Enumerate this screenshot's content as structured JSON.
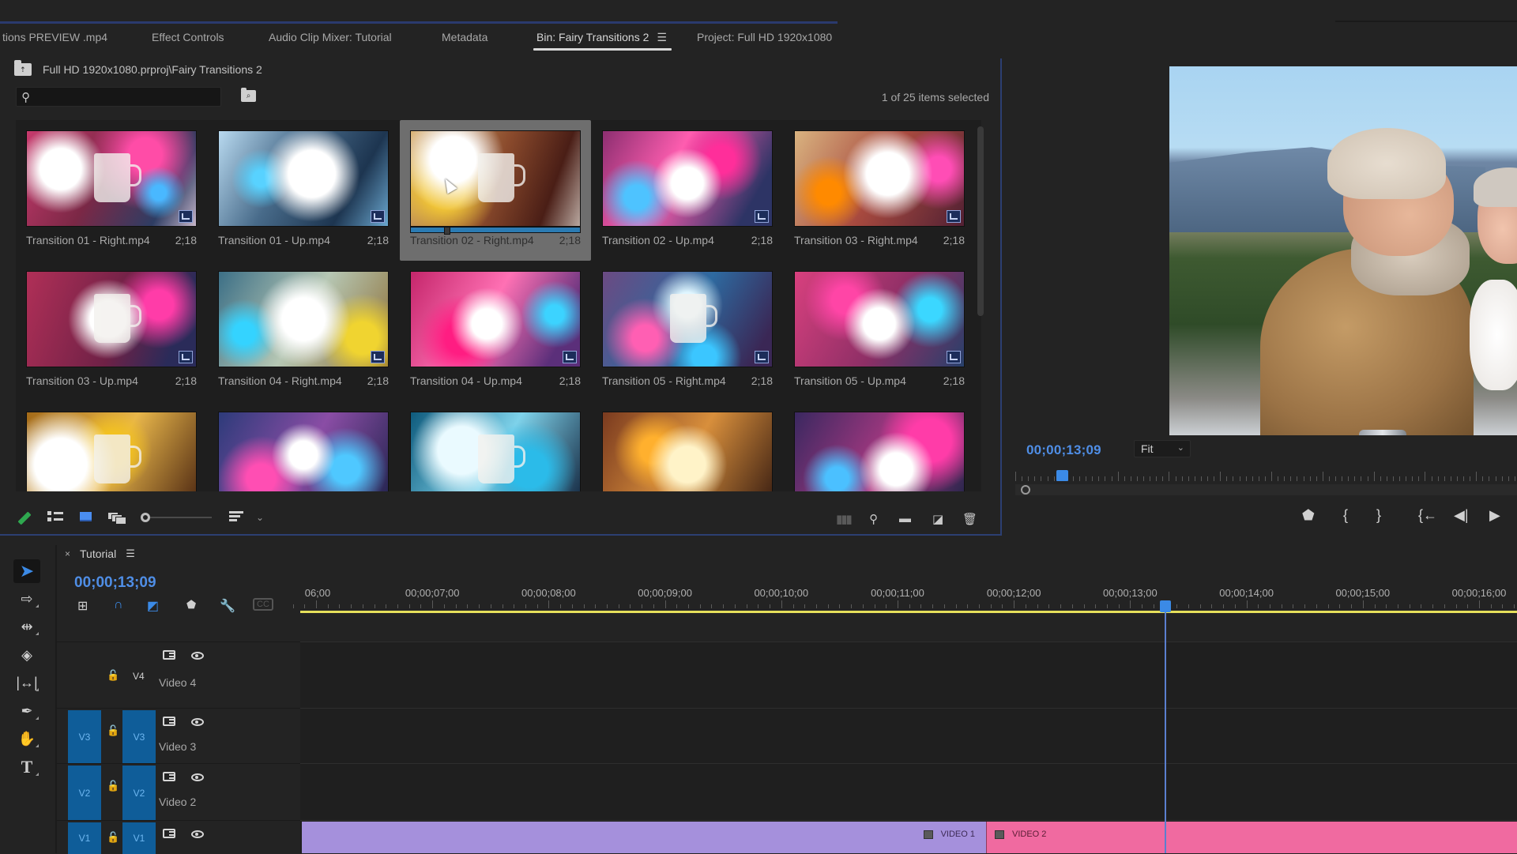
{
  "tabs": [
    {
      "label": "tions PREVIEW .mp4",
      "active": false
    },
    {
      "label": "Effect Controls",
      "active": false
    },
    {
      "label": "Audio Clip Mixer: Tutorial",
      "active": false
    },
    {
      "label": "Metadata",
      "active": false
    },
    {
      "label": "Bin: Fairy Transitions 2",
      "active": true
    },
    {
      "label": "Project: Full HD 1920x1080",
      "active": false
    }
  ],
  "bin": {
    "path": "Full HD 1920x1080.prproj\\Fairy Transitions 2",
    "search_placeholder": "",
    "search_value": "",
    "selection_count": "1 of 25 items selected",
    "items": [
      {
        "name": "Transition 01 - Right.mp4",
        "duration": "2;18",
        "selected": false
      },
      {
        "name": "Transition 01 - Up.mp4",
        "duration": "2;18",
        "selected": false
      },
      {
        "name": "Transition 02  - Right.mp4",
        "duration": "2;18",
        "selected": true,
        "scrub_position": 0.2
      },
      {
        "name": "Transition 02  - Up.mp4",
        "duration": "2;18",
        "selected": false
      },
      {
        "name": "Transition 03  - Right.mp4",
        "duration": "2;18",
        "selected": false
      },
      {
        "name": "Transition 03  - Up.mp4",
        "duration": "2;18",
        "selected": false
      },
      {
        "name": "Transition 04  - Right.mp4",
        "duration": "2;18",
        "selected": false
      },
      {
        "name": "Transition 04  - Up.mp4",
        "duration": "2;18",
        "selected": false
      },
      {
        "name": "Transition 05  - Right.mp4",
        "duration": "2;18",
        "selected": false
      },
      {
        "name": "Transition 05  - Up.mp4",
        "duration": "2;18",
        "selected": false
      },
      {
        "name": "",
        "duration": "",
        "selected": false
      },
      {
        "name": "",
        "duration": "",
        "selected": false
      },
      {
        "name": "",
        "duration": "",
        "selected": false
      },
      {
        "name": "",
        "duration": "",
        "selected": false
      },
      {
        "name": "",
        "duration": "",
        "selected": false
      }
    ],
    "toolbar": {
      "left_icons": [
        "pencil-icon",
        "list-view-icon",
        "icon-view-icon",
        "freeform-view-icon",
        "zoom-slider",
        "sort-icon",
        "chevron-down-icon"
      ],
      "right_icons": [
        "automate-to-sequence-icon",
        "find-icon",
        "new-bin-icon",
        "new-item-icon",
        "trash-icon"
      ]
    }
  },
  "program": {
    "timecode": "00;00;13;09",
    "zoom_select": "Fit",
    "playhead_fraction": 0.09,
    "transport_icons": [
      "add-marker-icon",
      "mark-in-icon",
      "mark-out-icon",
      "go-to-in-icon",
      "step-back-icon",
      "play-icon"
    ]
  },
  "timeline": {
    "sequence_name": "Tutorial",
    "timecode": "00;00;13;09",
    "ruler_labels": [
      "06;00",
      "00;00;07;00",
      "00;00;08;00",
      "00;00;09;00",
      "00;00;10;00",
      "00;00;11;00",
      "00;00;12;00",
      "00;00;13;00",
      "00;00;14;00",
      "00;00;15;00",
      "00;00;16;00"
    ],
    "playhead_seconds": 13.3,
    "tools": [
      "selection-tool",
      "track-select-forward-tool",
      "ripple-edit-tool",
      "razor-tool",
      "slip-tool",
      "pen-tool",
      "hand-tool",
      "type-tool"
    ],
    "seq_tools": [
      "insert-nest-icon",
      "snap-icon",
      "linked-selection-icon",
      "add-marker-icon",
      "wrench-icon",
      "captions-icon"
    ],
    "tracks": [
      {
        "source": "",
        "target": "V4",
        "name": "Video 4"
      },
      {
        "source": "V3",
        "target": "V3",
        "name": "Video 3"
      },
      {
        "source": "V2",
        "target": "V2",
        "name": "Video 2"
      },
      {
        "source": "V1",
        "target": "V1",
        "name": ""
      }
    ],
    "clips": [
      {
        "label": "VIDEO 1",
        "color": "#a590dc"
      },
      {
        "label": "VIDEO 2",
        "color": "#f06aa0"
      }
    ]
  },
  "colors": {
    "accent_blue": "#4f8ee6",
    "panel_border": "#2c3f72",
    "work_area": "#e5df5a"
  }
}
